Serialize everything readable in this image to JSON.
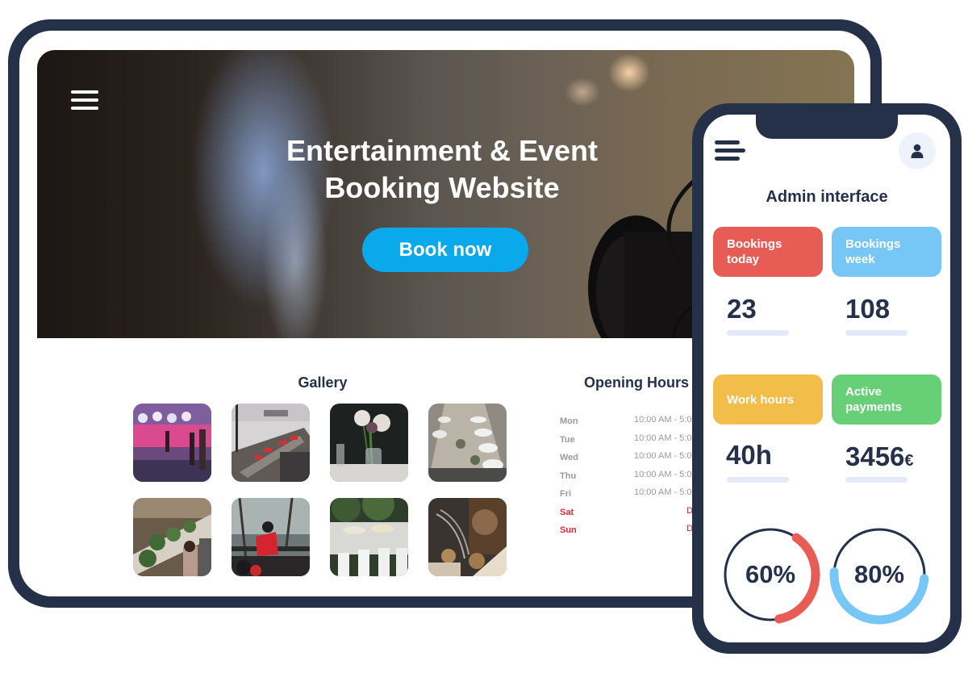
{
  "tablet": {
    "hero": {
      "title_line1": "Entertainment & Event",
      "title_line2": "Booking Website",
      "cta_label": "Book now",
      "menu_icon": "hamburger-menu-icon"
    },
    "gallery": {
      "title": "Gallery",
      "items": [
        {
          "label": "festival-crowd-pink-lights"
        },
        {
          "label": "beach-table-red-napkins"
        },
        {
          "label": "flower-centerpiece-table"
        },
        {
          "label": "long-banquet-table-plates"
        },
        {
          "label": "guests-preparing-greens"
        },
        {
          "label": "person-red-jacket-outdoor"
        },
        {
          "label": "white-chairs-garden-table"
        },
        {
          "label": "rustic-dried-flower-decor"
        }
      ]
    },
    "opening_hours": {
      "title": "Opening Hours",
      "rows": [
        {
          "day": "Mon",
          "time": "10:00 AM - 5:0",
          "closed": false
        },
        {
          "day": "Tue",
          "time": "10:00 AM - 5:0",
          "closed": false
        },
        {
          "day": "Wed",
          "time": "10:00 AM - 5:0",
          "closed": false
        },
        {
          "day": "Thu",
          "time": "10:00 AM - 5:0",
          "closed": false
        },
        {
          "day": "Fri",
          "time": "10:00 AM - 5:0",
          "closed": false
        },
        {
          "day": "Sat",
          "time": "D",
          "closed": true
        },
        {
          "day": "Sun",
          "time": "D",
          "closed": true
        }
      ]
    }
  },
  "phone": {
    "title": "Admin interface",
    "menu_icon": "hamburger-menu-icon",
    "avatar_icon": "user-icon",
    "stats": [
      {
        "label": "Bookings today",
        "value": "23",
        "unit": "",
        "color": "#e85c56"
      },
      {
        "label": "Bookings week",
        "value": "108",
        "unit": "",
        "color": "#76c7f6"
      },
      {
        "label": "Work hours",
        "value": "40h",
        "unit": "",
        "color": "#f3bd49"
      },
      {
        "label": "Active payments",
        "value": "3456",
        "unit": "€",
        "color": "#67d076"
      }
    ],
    "rings": [
      {
        "label": "60%",
        "percent": 60,
        "color": "#e85c56"
      },
      {
        "label": "80%",
        "percent": 80,
        "color": "#76c7f6"
      }
    ]
  },
  "colors": {
    "frame": "#243148",
    "accent_button": "#0aa9ec",
    "text_dark": "#25314a",
    "closed_red": "#e0283a",
    "muted_gray": "#9a9a9a"
  }
}
